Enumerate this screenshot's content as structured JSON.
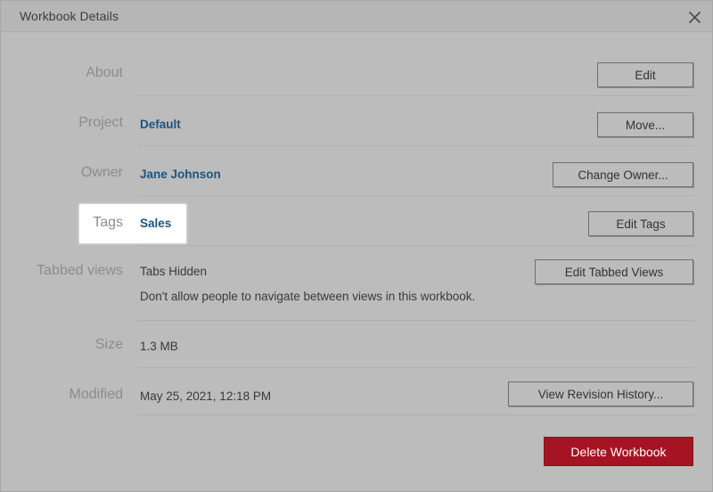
{
  "window": {
    "title": "Workbook Details",
    "close_icon": "close-icon"
  },
  "rows": {
    "about": {
      "label": "About",
      "button": "Edit"
    },
    "project": {
      "label": "Project",
      "value": "Default",
      "button": "Move..."
    },
    "owner": {
      "label": "Owner",
      "value": "Jane Johnson",
      "button": "Change Owner..."
    },
    "tags": {
      "label": "Tags",
      "value": "Sales",
      "button": "Edit Tags"
    },
    "tabbed_views": {
      "label": "Tabbed views",
      "value": "Tabs Hidden",
      "description": "Don't allow people to navigate between views in this workbook.",
      "button": "Edit Tabbed Views"
    },
    "size": {
      "label": "Size",
      "value": "1.3 MB"
    },
    "modified": {
      "label": "Modified",
      "value": "May 25, 2021, 12:18 PM",
      "button": "View Revision History..."
    }
  },
  "footer": {
    "delete_button": "Delete Workbook"
  },
  "colors": {
    "dialog_background": "#bcbcbc",
    "titlebar_background": "#b6b6b6",
    "link": "#1c5481",
    "label": "#8c8c8c",
    "danger": "#a51423",
    "separator": "#b0b0b0",
    "highlight": "#ffffff"
  }
}
